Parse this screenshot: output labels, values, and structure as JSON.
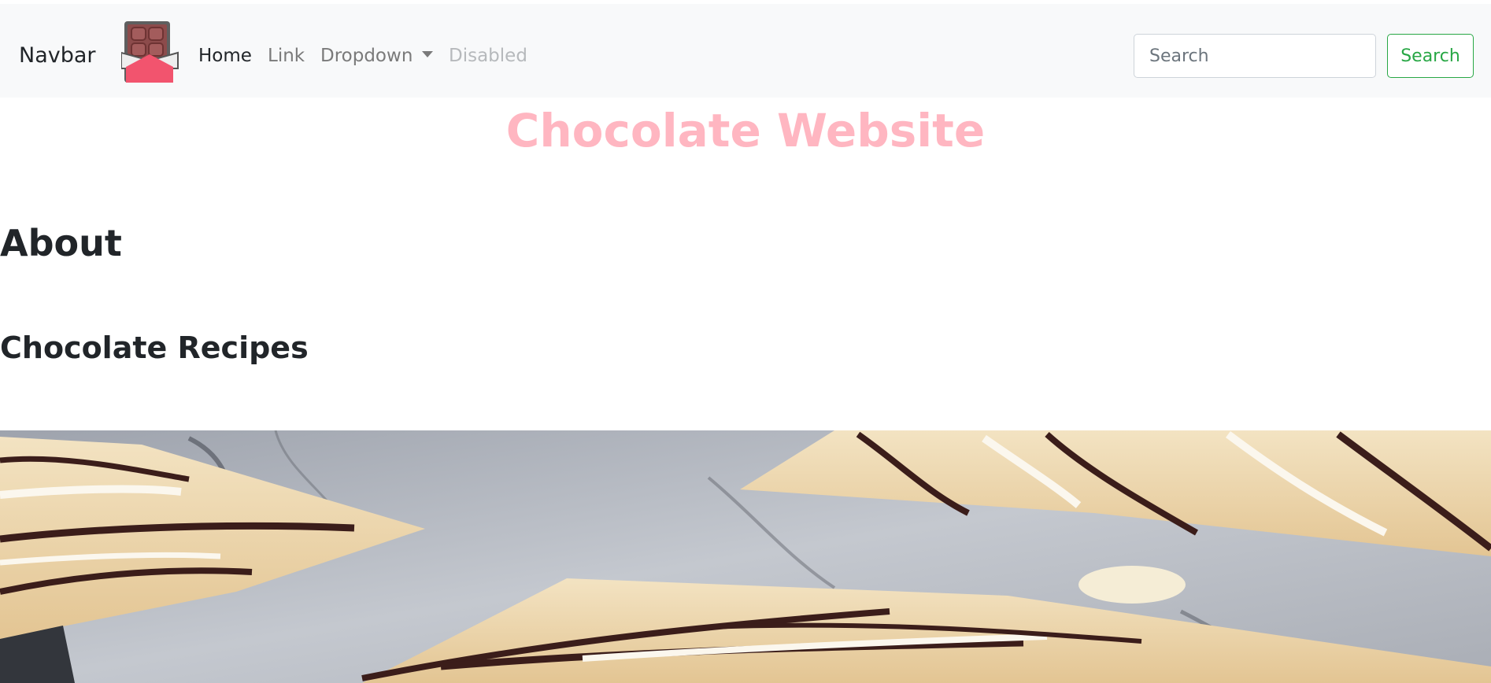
{
  "navbar": {
    "brand": "Navbar",
    "logo_icon": "chocolate-bar-icon",
    "links": [
      {
        "label": "Home",
        "state": "active"
      },
      {
        "label": "Link",
        "state": "normal"
      },
      {
        "label": "Dropdown",
        "state": "normal"
      },
      {
        "label": "Disabled",
        "state": "disabled"
      }
    ],
    "search": {
      "placeholder": "Search",
      "value": "",
      "button_label": "Search"
    }
  },
  "main": {
    "title": "Chocolate Website",
    "about_heading": "About",
    "recipes_heading": "Chocolate Recipes"
  },
  "colors": {
    "navbar_bg": "#f8f9fa",
    "title": "#ffb6c1",
    "search_button": "#28a745",
    "text": "#212529"
  }
}
